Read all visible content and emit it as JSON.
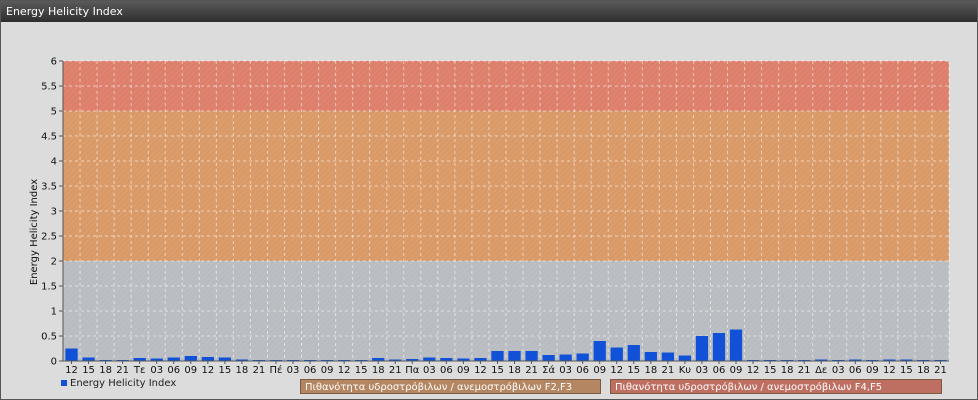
{
  "window": {
    "title": "Energy Helicity Index"
  },
  "colors": {
    "bar": "#1151d8",
    "band_low": "#b9bdc2",
    "band_mid": "#d99a68",
    "band_high": "#dd7f6b"
  },
  "legend": {
    "series_label": "Energy Helicity Index",
    "band1_label": "Πιθανότητα υδροστρόβιλων / ανεμοστρόβιλων F2,F3",
    "band2_label": "Πιθανότητα υδροστρόβιλων / ανεμοστρόβιλων F4,F5"
  },
  "chart_data": {
    "type": "bar",
    "ylabel": "Energy Helicity Index",
    "ylim": [
      0,
      6
    ],
    "yticks": [
      "0",
      "0.5",
      "1",
      "1.5",
      "2",
      "2.5",
      "3",
      "3.5",
      "4",
      "4.5",
      "5",
      "5.5",
      "6"
    ],
    "grid": true,
    "bands": [
      {
        "from": 0,
        "to": 2,
        "color": "#b9bdc2"
      },
      {
        "from": 2,
        "to": 5,
        "color": "#d99a68"
      },
      {
        "from": 5,
        "to": 6,
        "color": "#dd7f6b"
      }
    ],
    "categories": [
      "12",
      "15",
      "18",
      "21",
      "Τε",
      "03",
      "06",
      "09",
      "12",
      "15",
      "18",
      "21",
      "Πέ",
      "03",
      "06",
      "09",
      "12",
      "15",
      "18",
      "21",
      "Πα",
      "03",
      "06",
      "09",
      "12",
      "15",
      "18",
      "21",
      "Σά",
      "03",
      "06",
      "09",
      "12",
      "15",
      "18",
      "21",
      "Κυ",
      "03",
      "06",
      "09",
      "12",
      "15",
      "18",
      "21",
      "Δε",
      "03",
      "06",
      "09",
      "12",
      "15",
      "18",
      "21"
    ],
    "series": [
      {
        "name": "Energy Helicity Index",
        "values": [
          0.25,
          0.07,
          0.02,
          0.02,
          0.06,
          0.05,
          0.07,
          0.1,
          0.08,
          0.07,
          0.03,
          0.02,
          0.02,
          0.02,
          0.02,
          0.02,
          0.02,
          0.02,
          0.06,
          0.03,
          0.04,
          0.07,
          0.06,
          0.05,
          0.06,
          0.2,
          0.2,
          0.2,
          0.12,
          0.13,
          0.15,
          0.4,
          0.27,
          0.32,
          0.18,
          0.17,
          0.11,
          0.5,
          0.56,
          0.63,
          0.02,
          0.02,
          0.02,
          0.02,
          0.03,
          0.02,
          0.03,
          0.02,
          0.03,
          0.03,
          0.02,
          0.02
        ]
      }
    ]
  }
}
